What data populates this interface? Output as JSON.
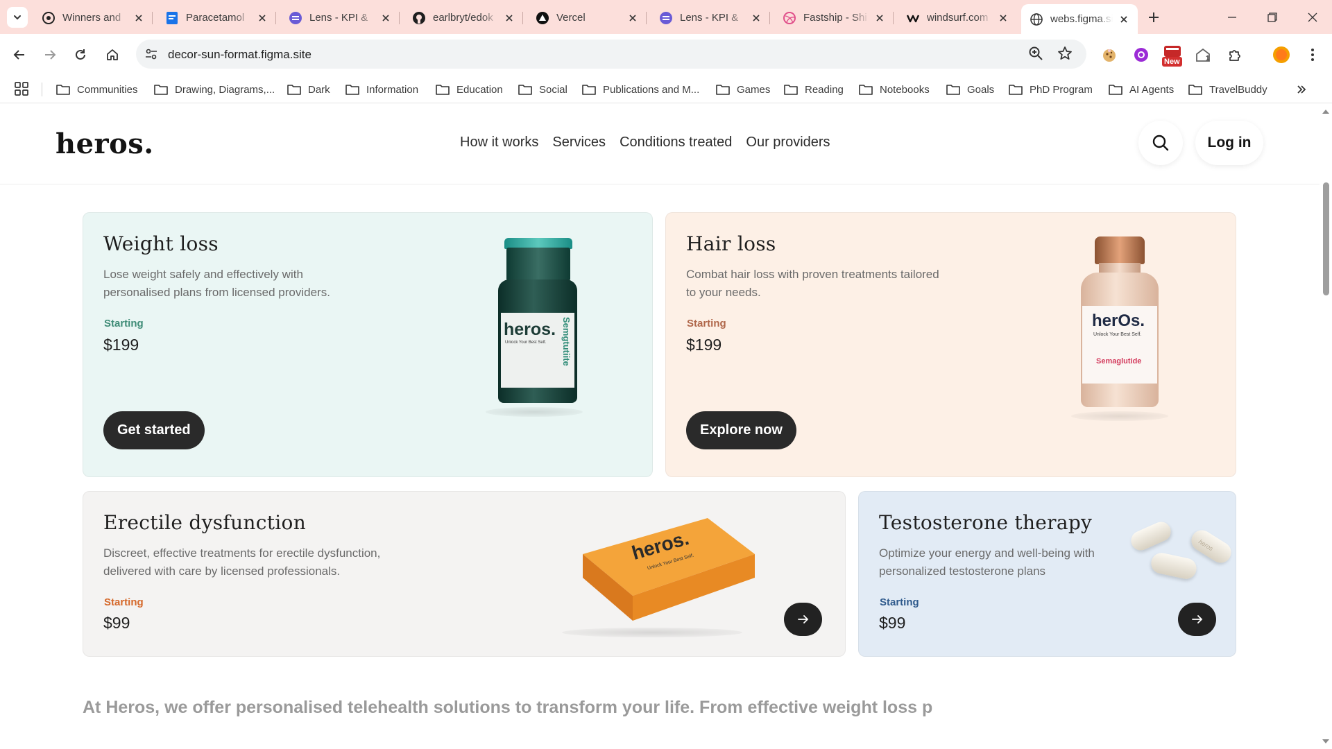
{
  "browser": {
    "tabs": [
      {
        "title": "Winners and",
        "icon": "openai-icon"
      },
      {
        "title": "Paracetamol",
        "icon": "docs-icon"
      },
      {
        "title": "Lens - KPI &",
        "icon": "lens-icon"
      },
      {
        "title": "earlbryt/edok",
        "icon": "github-icon"
      },
      {
        "title": "Vercel",
        "icon": "vercel-icon"
      },
      {
        "title": "Lens - KPI &",
        "icon": "lens-icon"
      },
      {
        "title": "Fastship - Shi",
        "icon": "dribbble-icon"
      },
      {
        "title": "windsurf.com",
        "icon": "windsurf-icon"
      },
      {
        "title": "webs.figma.si",
        "icon": "globe-icon"
      }
    ],
    "url": "decor-sun-format.figma.site",
    "extension_badge": "New",
    "extension_count": "1",
    "bookmarks": [
      "Communities",
      "Drawing, Diagrams,...",
      "Dark",
      "Information",
      "Education",
      "Social",
      "Publications and M...",
      "Games",
      "Reading",
      "Notebooks",
      "Goals",
      "PhD Program",
      "AI Agents",
      "TravelBuddy"
    ]
  },
  "site": {
    "logo": "heros.",
    "nav": [
      "How it works",
      "Services",
      "Conditions treated",
      "Our providers"
    ],
    "login": "Log in",
    "cards": {
      "weight": {
        "title": "Weight loss",
        "desc_1": "Lose weight safely and effectively with",
        "desc_2": "personalised plans from licensed providers.",
        "starting": "Starting",
        "price": "$199",
        "cta": "Get started",
        "product_brand": "heros.",
        "product_sub": "Unlock Your Best Self.",
        "product_name": "Semgtutiite",
        "accent": "#3f8c77"
      },
      "hair": {
        "title": "Hair loss",
        "desc_1": "Combat hair loss with proven treatments tailored",
        "desc_2": "to your needs.",
        "starting": "Starting",
        "price": "$199",
        "cta": "Explore now",
        "product_brand": "herOs.",
        "product_sub": "Unlock Your Best Self.",
        "product_name": "Semaglutide",
        "accent": "#b0674a"
      },
      "ed": {
        "title": "Erectile dysfunction",
        "desc_1": "Discreet, effective treatments for erectile dysfunction,",
        "desc_2": "delivered with care by licensed professionals.",
        "starting": "Starting",
        "price": "$99",
        "product_brand": "heros.",
        "product_sub": "Unlock Your Best Self.",
        "accent": "#d5682a"
      },
      "testo": {
        "title": "Testosterone therapy",
        "desc_1": "Optimize your energy and well-being with",
        "desc_2": "personalized testosterone plans",
        "starting": "Starting",
        "price": "$99",
        "pill_text": "heros",
        "accent": "#2f5a8c"
      }
    },
    "tagline": "At Heros, we offer personalised telehealth solutions to transform your life. From effective weight loss p"
  }
}
